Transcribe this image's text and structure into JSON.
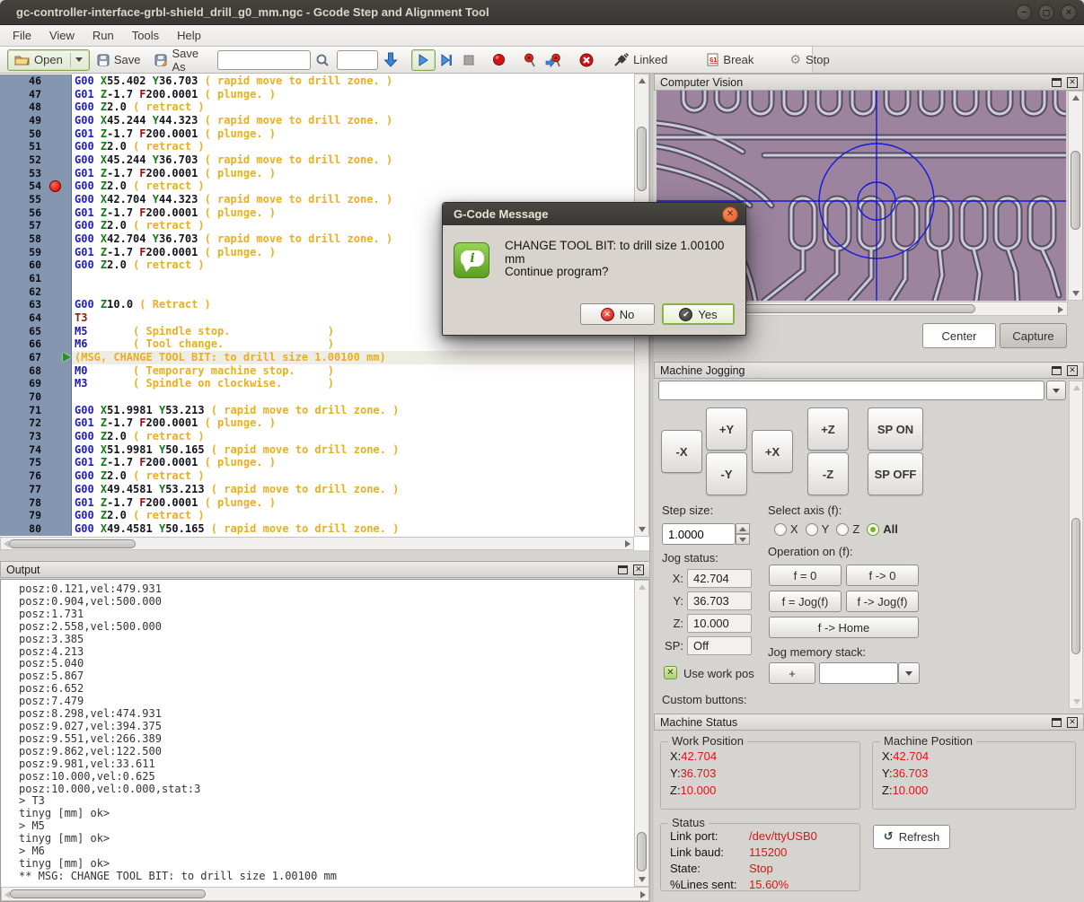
{
  "window": {
    "title": "gc-controller-interface-grbl-shield_drill_g0_mm.ngc - Gcode Step and Alignment Tool",
    "minimize": "−",
    "maximize": "▢",
    "close": "×"
  },
  "menu": {
    "items": [
      "File",
      "View",
      "Run",
      "Tools",
      "Help"
    ]
  },
  "toolbar": {
    "open": "Open",
    "save": "Save",
    "save_as": "Save As",
    "search_value": "",
    "goto_value": "",
    "linked": "Linked",
    "break": "Break",
    "stop": "Stop"
  },
  "editor": {
    "breakpoint_line": 54,
    "current_line": 67,
    "lines": [
      {
        "n": 46,
        "t": "G00 X55.402 Y36.703 ( rapid move to drill zone. )"
      },
      {
        "n": 47,
        "t": "G01 Z-1.7 F200.0001 ( plunge. )"
      },
      {
        "n": 48,
        "t": "G00 Z2.0 ( retract )"
      },
      {
        "n": 49,
        "t": "G00 X45.244 Y44.323 ( rapid move to drill zone. )"
      },
      {
        "n": 50,
        "t": "G01 Z-1.7 F200.0001 ( plunge. )"
      },
      {
        "n": 51,
        "t": "G00 Z2.0 ( retract )"
      },
      {
        "n": 52,
        "t": "G00 X45.244 Y36.703 ( rapid move to drill zone. )"
      },
      {
        "n": 53,
        "t": "G01 Z-1.7 F200.0001 ( plunge. )"
      },
      {
        "n": 54,
        "t": "G00 Z2.0 ( retract )"
      },
      {
        "n": 55,
        "t": "G00 X42.704 Y44.323 ( rapid move to drill zone. )"
      },
      {
        "n": 56,
        "t": "G01 Z-1.7 F200.0001 ( plunge. )"
      },
      {
        "n": 57,
        "t": "G00 Z2.0 ( retract )"
      },
      {
        "n": 58,
        "t": "G00 X42.704 Y36.703 ( rapid move to drill zone. )"
      },
      {
        "n": 59,
        "t": "G01 Z-1.7 F200.0001 ( plunge. )"
      },
      {
        "n": 60,
        "t": "G00 Z2.0 ( retract )"
      },
      {
        "n": 61,
        "t": ""
      },
      {
        "n": 62,
        "t": ""
      },
      {
        "n": 63,
        "t": "G00 Z10.0 ( Retract )"
      },
      {
        "n": 64,
        "t": "T3"
      },
      {
        "n": 65,
        "t": "M5       ( Spindle stop.               )"
      },
      {
        "n": 66,
        "t": "M6       ( Tool change.                )"
      },
      {
        "n": 67,
        "t": "(MSG, CHANGE TOOL BIT: to drill size 1.00100 mm)"
      },
      {
        "n": 68,
        "t": "M0       ( Temporary machine stop.     )"
      },
      {
        "n": 69,
        "t": "M3       ( Spindle on clockwise.       )"
      },
      {
        "n": 70,
        "t": ""
      },
      {
        "n": 71,
        "t": "G00 X51.9981 Y53.213 ( rapid move to drill zone. )"
      },
      {
        "n": 72,
        "t": "G01 Z-1.7 F200.0001 ( plunge. )"
      },
      {
        "n": 73,
        "t": "G00 Z2.0 ( retract )"
      },
      {
        "n": 74,
        "t": "G00 X51.9981 Y50.165 ( rapid move to drill zone. )"
      },
      {
        "n": 75,
        "t": "G01 Z-1.7 F200.0001 ( plunge. )"
      },
      {
        "n": 76,
        "t": "G00 Z2.0 ( retract )"
      },
      {
        "n": 77,
        "t": "G00 X49.4581 Y53.213 ( rapid move to drill zone. )"
      },
      {
        "n": 78,
        "t": "G01 Z-1.7 F200.0001 ( plunge. )"
      },
      {
        "n": 79,
        "t": "G00 Z2.0 ( retract )"
      },
      {
        "n": 80,
        "t": "G00 X49.4581 Y50.165 ( rapid move to drill zone. )"
      }
    ]
  },
  "output": {
    "title": "Output",
    "lines": [
      "posz:0.121,vel:479.931",
      "posz:0.904,vel:500.000",
      "posz:1.731",
      "posz:2.558,vel:500.000",
      "posz:3.385",
      "posz:4.213",
      "posz:5.040",
      "posz:5.867",
      "posz:6.652",
      "posz:7.479",
      "posz:8.298,vel:474.931",
      "posz:9.027,vel:394.375",
      "posz:9.551,vel:266.389",
      "posz:9.862,vel:122.500",
      "posz:9.981,vel:33.611",
      "posz:10.000,vel:0.625",
      "posz:10.000,vel:0.000,stat:3",
      "> T3",
      "tinyg [mm] ok>",
      "> M5",
      "tinyg [mm] ok>",
      "> M6",
      "tinyg [mm] ok>",
      "** MSG: CHANGE TOOL BIT: to drill size 1.00100 mm"
    ]
  },
  "cv": {
    "title": "Computer Vision",
    "center": "Center",
    "capture": "Capture"
  },
  "jogging": {
    "title": "Machine Jogging",
    "combo_value": "",
    "btn_x_minus": "-X",
    "btn_y_plus": "+Y",
    "btn_y_minus": "-Y",
    "btn_x_plus": "+X",
    "btn_z_plus": "+Z",
    "btn_z_minus": "-Z",
    "btn_sp_on": "SP ON",
    "btn_sp_off": "SP OFF",
    "step_size_label": "Step size:",
    "step_size": "1.0000",
    "select_axis_label": "Select axis (f):",
    "axes": [
      "X",
      "Y",
      "Z",
      "All"
    ],
    "selected_axis": "All",
    "jog_status_label": "Jog status:",
    "fields": [
      {
        "label": "X:",
        "value": "42.704"
      },
      {
        "label": "Y:",
        "value": "36.703"
      },
      {
        "label": "Z:",
        "value": "10.000"
      },
      {
        "label": "SP:",
        "value": "Off"
      }
    ],
    "use_work_pos": "Use work pos",
    "operation_label": "Operation on (f):",
    "op_buttons": [
      "f = 0",
      "f -> 0",
      "f = Jog(f)",
      "f -> Jog(f)",
      "f -> Home"
    ],
    "jog_memory_label": "Jog memory stack:",
    "plus": "+",
    "memory_value": "",
    "custom_buttons_label": "Custom buttons:"
  },
  "status": {
    "title": "Machine Status",
    "work": {
      "legend": "Work Position",
      "rows": [
        {
          "label": "X:",
          "value": "42.704"
        },
        {
          "label": "Y:",
          "value": "36.703"
        },
        {
          "label": "Z:",
          "value": "10.000"
        }
      ]
    },
    "machine": {
      "legend": "Machine Position",
      "rows": [
        {
          "label": "X:",
          "value": "42.704"
        },
        {
          "label": "Y:",
          "value": "36.703"
        },
        {
          "label": "Z:",
          "value": "10.000"
        }
      ]
    },
    "stat": {
      "legend": "Status",
      "rows": [
        {
          "label": "Link port:",
          "value": "/dev/ttyUSB0"
        },
        {
          "label": "Link baud:",
          "value": "115200"
        },
        {
          "label": "State:",
          "value": "Stop"
        },
        {
          "label": "%Lines sent:",
          "value": "15.60%"
        }
      ]
    },
    "refresh": "Refresh"
  },
  "dialog": {
    "title": "G-Code Message",
    "message": "CHANGE TOOL BIT: to drill size 1.00100 mm",
    "question": "Continue program?",
    "no": "No",
    "yes": "Yes"
  },
  "colors": {
    "value_red": "#e31212",
    "comment_gold": "#e9af1f",
    "gcode_blue": "#2121cd",
    "axis_green": "#157915",
    "breakpoint_red": "#d40000",
    "crosshair_blue": "#1717dd"
  }
}
